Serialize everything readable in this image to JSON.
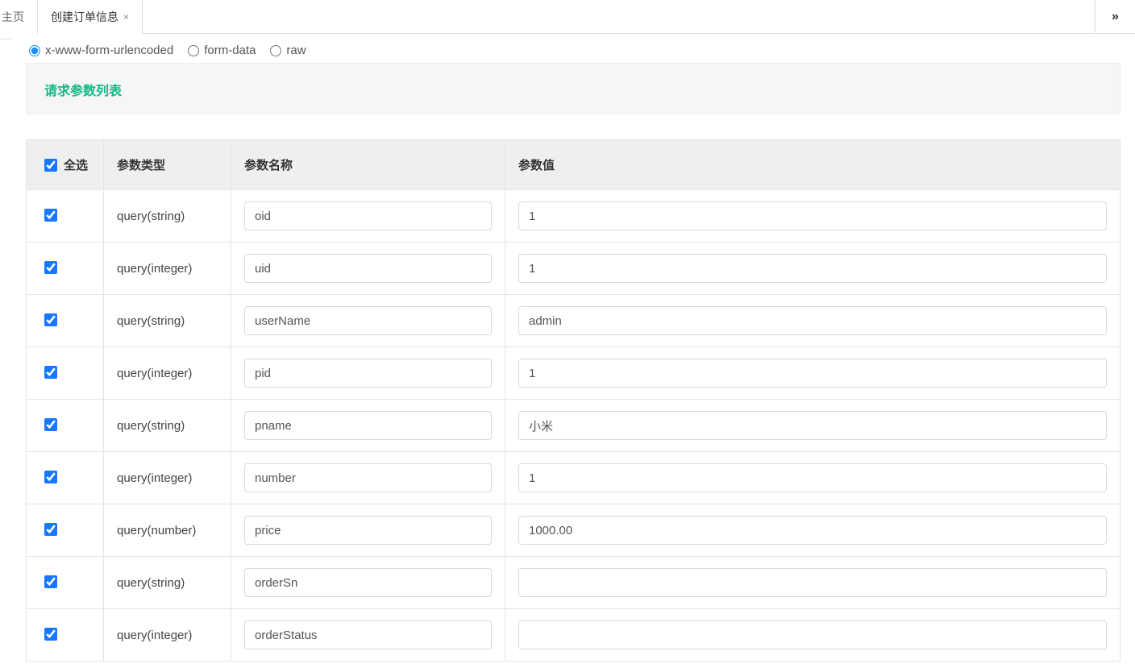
{
  "tabs": {
    "home_label": "主页",
    "items": [
      {
        "label": "创建订单信息"
      }
    ],
    "expand_icon": "»"
  },
  "body_types": {
    "options": [
      {
        "label": "x-www-form-urlencoded",
        "checked": true
      },
      {
        "label": "form-data",
        "checked": false
      },
      {
        "label": "raw",
        "checked": false
      }
    ]
  },
  "section": {
    "title": "请求参数列表"
  },
  "table": {
    "headers": {
      "select_all": "全选",
      "param_type": "参数类型",
      "param_name": "参数名称",
      "param_value": "参数值"
    },
    "rows": [
      {
        "checked": true,
        "type": "query(string)",
        "name": "oid",
        "value": "1"
      },
      {
        "checked": true,
        "type": "query(integer)",
        "name": "uid",
        "value": "1"
      },
      {
        "checked": true,
        "type": "query(string)",
        "name": "userName",
        "value": "admin"
      },
      {
        "checked": true,
        "type": "query(integer)",
        "name": "pid",
        "value": "1"
      },
      {
        "checked": true,
        "type": "query(string)",
        "name": "pname",
        "value": "小米"
      },
      {
        "checked": true,
        "type": "query(integer)",
        "name": "number",
        "value": "1"
      },
      {
        "checked": true,
        "type": "query(number)",
        "name": "price",
        "value": "1000.00"
      },
      {
        "checked": true,
        "type": "query(string)",
        "name": "orderSn",
        "value": ""
      },
      {
        "checked": true,
        "type": "query(integer)",
        "name": "orderStatus",
        "value": ""
      }
    ]
  }
}
